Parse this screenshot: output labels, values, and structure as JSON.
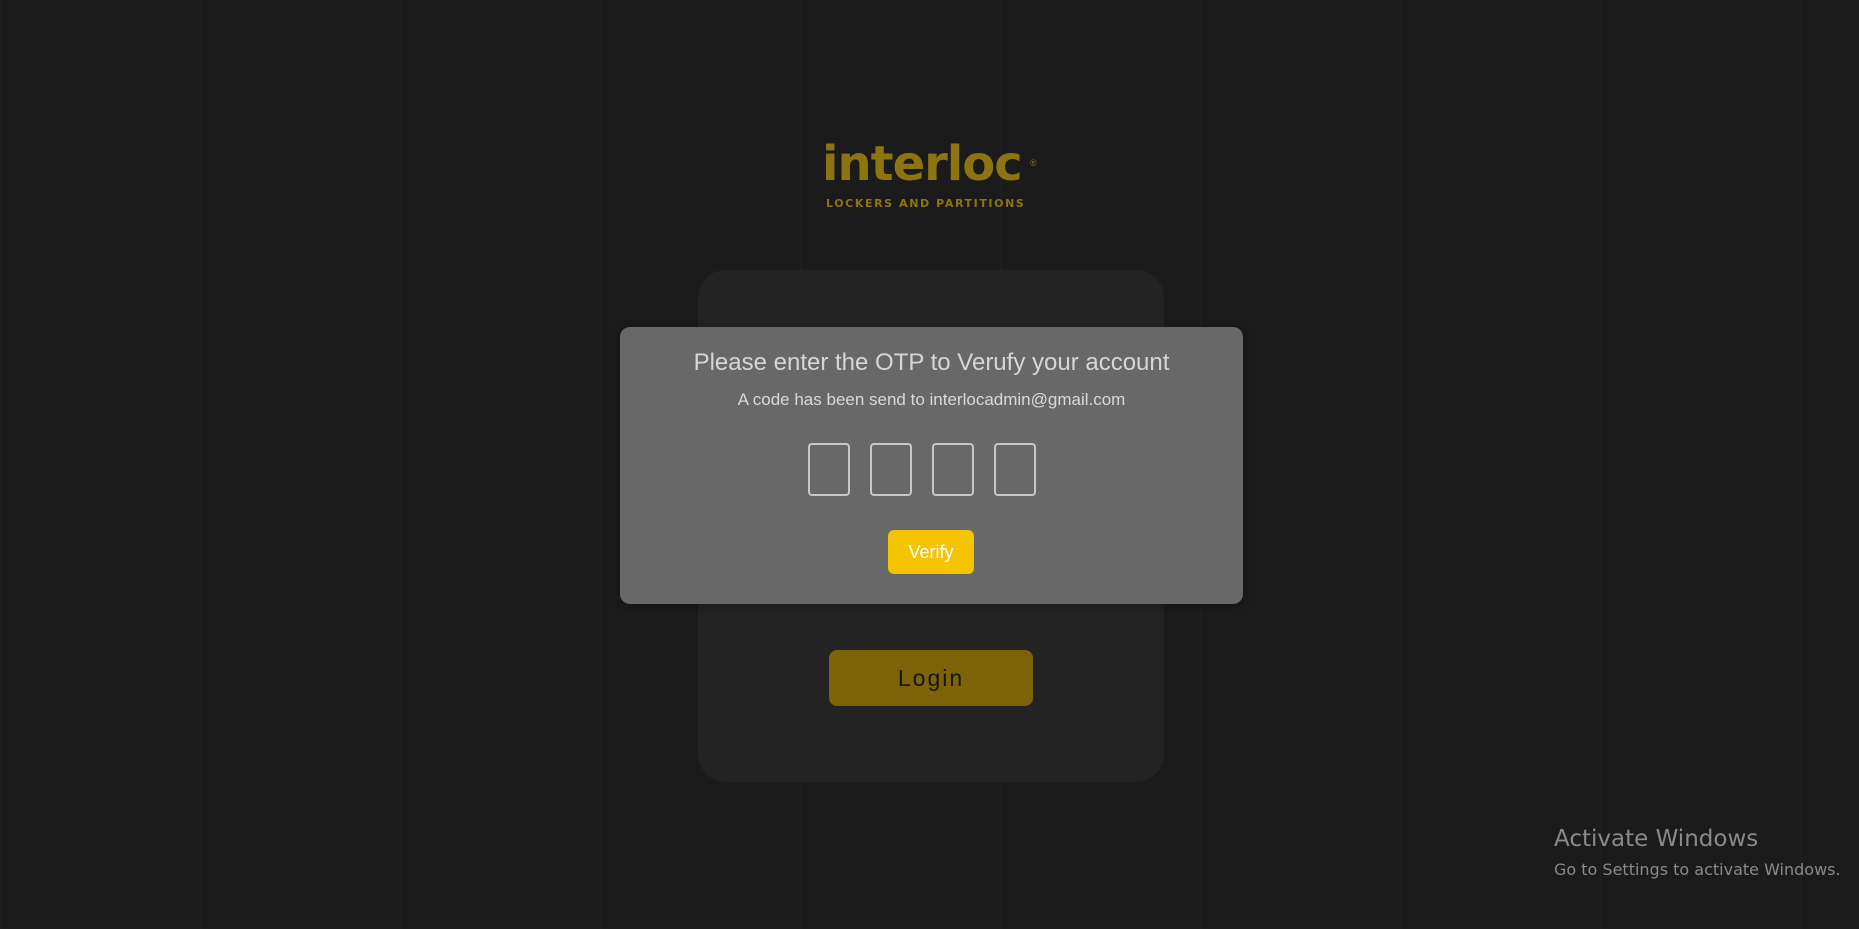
{
  "logo": {
    "wordmark": "interloc",
    "registered_mark": "®",
    "tagline": "LOCKERS AND PARTITIONS",
    "color": "#8d7410"
  },
  "login_card": {
    "login_button_label": "Login"
  },
  "otp_modal": {
    "title": "Please enter the OTP to Verufy your account",
    "subtitle": "A code has been send to interlocadmin@gmail.com",
    "otp_digits": [
      "",
      "",
      "",
      ""
    ],
    "verify_button_label": "Verify",
    "accent_color": "#f4c400"
  },
  "watermark": {
    "title": "Activate Windows",
    "subtitle": "Go to Settings to activate Windows."
  }
}
